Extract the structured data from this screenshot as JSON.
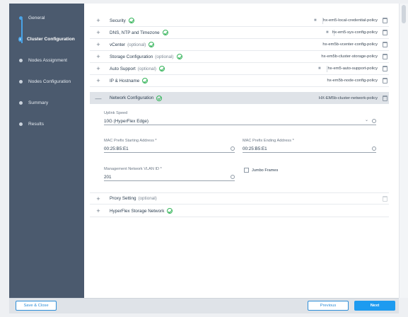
{
  "wizard": {
    "steps": [
      {
        "label": "General"
      },
      {
        "label": "Cluster Configuration"
      },
      {
        "label": "Nodes Assignment"
      },
      {
        "label": "Nodes Configuration"
      },
      {
        "label": "Summary"
      },
      {
        "label": "Results"
      }
    ],
    "active_step": "Cluster Configuration"
  },
  "sections": [
    {
      "title": "Security",
      "optional": "",
      "status": "check-circle-icon",
      "locked": true,
      "policy": "hx-em5-local-credential-policy"
    },
    {
      "title": "DNS, NTP and Timezone",
      "optional": "",
      "status": "check-circle-icon",
      "locked": true,
      "policy": "hx-em5-sys-config-policy"
    },
    {
      "title": "vCenter",
      "optional": "(optional)",
      "status": "check-circle-icon",
      "locked": false,
      "policy": "hx-em5b-vcenter-config-policy"
    },
    {
      "title": "Storage Configuration",
      "optional": "(optional)",
      "status": "check-circle-icon",
      "locked": false,
      "policy": "hx-em5b-cluster-storage-policy"
    },
    {
      "title": "Auto Support",
      "optional": "(optional)",
      "status": "check-circle-icon",
      "locked": true,
      "policy": "hx-em5-auto-support-policy"
    },
    {
      "title": "IP & Hostname",
      "optional": "",
      "status": "check-circle-icon",
      "locked": false,
      "policy": "hx-em5b-node-config-policy"
    },
    {
      "title": "Network Configuration",
      "optional": "",
      "status": "check-circle-icon",
      "locked": false,
      "policy": "HX-EM5b-cluster-network-policy",
      "expanded": true
    }
  ],
  "network": {
    "uplink_speed_label": "Uplink Speed",
    "uplink_speed_value": "10G (HyperFlex Edge)",
    "mac_start_label": "MAC Prefix Starting Address *",
    "mac_start_value": "00:25:B5:E1",
    "mac_end_label": "MAC Prefix Ending Address *",
    "mac_end_value": "00:25:B5:E1",
    "vlan_label": "Management Network VLAN ID *",
    "vlan_value": "201",
    "jumbo_label": "Jumbo Frames",
    "jumbo_checked": false
  },
  "collapsed_sections": [
    {
      "title": "Proxy Setting",
      "optional": "(optional)"
    },
    {
      "title": "HyperFlex Storage Network",
      "optional": ""
    }
  ],
  "footer": {
    "save_close": "Save & Close",
    "previous": "Previous",
    "next": "Next"
  }
}
